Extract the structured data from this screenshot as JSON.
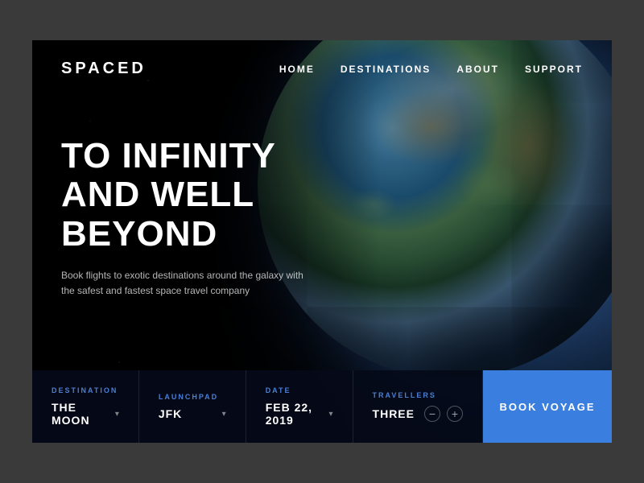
{
  "app": {
    "name": "SPACED"
  },
  "nav": {
    "links": [
      {
        "id": "home",
        "label": "HOME"
      },
      {
        "id": "destinations",
        "label": "DESTINATIONS"
      },
      {
        "id": "about",
        "label": "ABOUT"
      },
      {
        "id": "support",
        "label": "SUPPORT"
      }
    ]
  },
  "hero": {
    "title_line1": "TO INFINITY",
    "title_line2": "AND WELL BEYOND",
    "subtitle": "Book flights to exotic destinations around the galaxy with the safest and fastest space travel company"
  },
  "booking": {
    "fields": [
      {
        "id": "destination",
        "label": "DESTINATION",
        "value": "THE MOON"
      },
      {
        "id": "launchpad",
        "label": "LAUNCHPAD",
        "value": "JFK"
      },
      {
        "id": "date",
        "label": "DATE",
        "value": "FEB 22, 2019"
      },
      {
        "id": "travellers",
        "label": "TRAVELLERS",
        "value": "THREE"
      }
    ],
    "book_button_label": "BOOK VOYAGE",
    "accent_color": "#3a7fdf",
    "label_color": "#4a7fd4"
  }
}
